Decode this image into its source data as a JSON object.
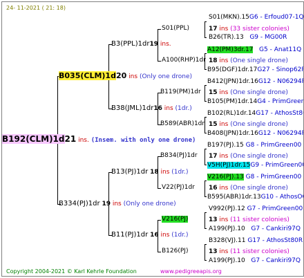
{
  "header": {
    "date": "24- 11-2021 ( 21: 18)"
  },
  "footer": {
    "copyright": "Copyright 2004-2021 © Karl Kehrle Foundation",
    "site": "www.pedigreeapis.org"
  },
  "root": {
    "name": "B192(CLM)1d",
    "num": "21",
    "ins": "ins.",
    "note": "(Insem. with only one drone)"
  },
  "gen1": [
    {
      "name": "B035(CLM)1d",
      "num": "20",
      "ins": "ins",
      "note": "(Only one drone)"
    },
    {
      "name": "B334(PJ)1dr",
      "num": "19",
      "ins": "ins",
      "note": "(Only one drone)"
    }
  ],
  "gen2": [
    {
      "name": "B3(PPL)1dr",
      "num": "19",
      "ins": "ins."
    },
    {
      "name": "B38(JML)1dr",
      "num": "16",
      "ins": "ins",
      "note": "(1dr.)"
    },
    {
      "name": "B13(PJ)1dr",
      "num": "18",
      "ins": "ins",
      "note": "(1dr.)"
    },
    {
      "name": "B11(PJ)1dr",
      "num": "16",
      "ins": "ins",
      "note": "(1dr.)"
    }
  ],
  "gen3": [
    {
      "name": "S01(PPL)",
      "num": "17",
      "ins": "ins"
    },
    {
      "name": "A100(RHP)1dr",
      "num": "18",
      "ins": "ins",
      "note": "(One single drone)"
    },
    {
      "name": "B119(PM)1dr",
      "num": "15",
      "ins": "ins",
      "note": "(One single drone)"
    },
    {
      "name": "B589(ABR)1dr",
      "num": "15",
      "ins": "ins",
      "note": "(One single drone)"
    },
    {
      "name": "B834(PJ)1dr",
      "num": "17",
      "ins": "ins",
      "note": "(One single drone)"
    },
    {
      "name": "V22(PJ)1dr",
      "num": "16",
      "ins": "ins",
      "note": "(One single drone)"
    },
    {
      "name": "V216(PJ)",
      "num": "13",
      "ins": "ins",
      "note": "(11 sister colonies)"
    },
    {
      "name": "B126(PJ)",
      "num": "13",
      "ins": "ins",
      "note": "(11 sister colonies)"
    }
  ],
  "gen4": [
    {
      "name": "S01(MKN).15",
      "info": "G6 - Erfoud07-1Q"
    },
    {
      "name": "B26(TR).13",
      "info": "G9 - MG00R"
    },
    {
      "name": "A12(PM)3dr.17",
      "info": "G5 - Anat11Q"
    },
    {
      "name": "B95(DGF)1dr.17",
      "info": "G27 - Sinop62R"
    },
    {
      "name": "B412(JPN)1dr.16",
      "info": "G12 - N06294R"
    },
    {
      "name": "B105(PM)1dr.14",
      "info": "G4 - PrimGreen00"
    },
    {
      "name": "B102(RL)1dr.14",
      "info": "G17 - AthosSt80R"
    },
    {
      "name": "B408(JPN)1dr.16",
      "info": "G12 - N06294R"
    },
    {
      "name": "B197(PJ).15",
      "info": "G8 - PrimGreen00"
    },
    {
      "name": "V5H(PJ)1dr.15",
      "info": "G9 - PrimGreen00"
    },
    {
      "name": "V216(PJ).13",
      "info": "G8 - PrimGreen00"
    },
    {
      "name": "B595(ABR)1dr.13",
      "info": "G10 - AthosOOR"
    },
    {
      "name": "V992(PJ).12",
      "info": "G7 - PrimGreen00"
    },
    {
      "name": "A199(PJ).10",
      "info": "G7 - Cankiri97Q"
    },
    {
      "name": "B328(VJ).11",
      "info": "G17 - AthosSt80R"
    },
    {
      "name": "A199(PJ).10",
      "info": "G7 - Cankiri97Q"
    }
  ]
}
